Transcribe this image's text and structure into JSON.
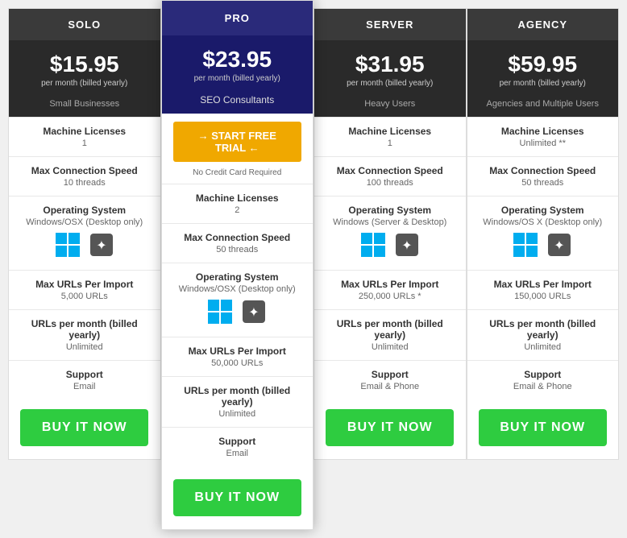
{
  "plans": [
    {
      "id": "solo",
      "name": "SOLO",
      "price": "$15.95",
      "period": "per month (billed yearly)",
      "subtitle": "Small Businesses",
      "featured": false,
      "trial_btn": null,
      "no_credit": null,
      "features": [
        {
          "label": "Machine Licenses",
          "value": "1"
        },
        {
          "label": "Max Connection Speed",
          "value": "10 threads"
        },
        {
          "label": "Operating System",
          "value": "Windows/OSX (Desktop only)"
        },
        {
          "label": "Max URLs Per Import",
          "value": "5,000 URLs"
        },
        {
          "label": "URLs per month (billed yearly)",
          "value": "Unlimited"
        },
        {
          "label": "Support",
          "value": "Email"
        }
      ],
      "buy_label": "BUY IT NOW"
    },
    {
      "id": "pro",
      "name": "PRO",
      "price": "$23.95",
      "period": "per month (billed yearly)",
      "subtitle": "SEO Consultants",
      "featured": true,
      "trial_btn": "→ START FREE TRIAL ←",
      "no_credit": "No Credit Card Required",
      "features": [
        {
          "label": "Machine Licenses",
          "value": "2"
        },
        {
          "label": "Max Connection Speed",
          "value": "50 threads"
        },
        {
          "label": "Operating System",
          "value": "Windows/OSX (Desktop only)"
        },
        {
          "label": "Max URLs Per Import",
          "value": "50,000 URLs"
        },
        {
          "label": "URLs per month (billed yearly)",
          "value": "Unlimited"
        },
        {
          "label": "Support",
          "value": "Email"
        }
      ],
      "buy_label": "BUY IT NOW"
    },
    {
      "id": "server",
      "name": "SERVER",
      "price": "$31.95",
      "period": "per month (billed yearly)",
      "subtitle": "Heavy Users",
      "featured": false,
      "trial_btn": null,
      "no_credit": null,
      "features": [
        {
          "label": "Machine Licenses",
          "value": "1"
        },
        {
          "label": "Max Connection Speed",
          "value": "100 threads"
        },
        {
          "label": "Operating System",
          "value": "Windows (Server & Desktop)"
        },
        {
          "label": "Max URLs Per Import",
          "value": "250,000 URLs *"
        },
        {
          "label": "URLs per month (billed yearly)",
          "value": "Unlimited"
        },
        {
          "label": "Support",
          "value": "Email & Phone"
        }
      ],
      "buy_label": "BUY IT NOW"
    },
    {
      "id": "agency",
      "name": "AGENCY",
      "price": "$59.95",
      "period": "per month (billed yearly)",
      "subtitle": "Agencies and Multiple Users",
      "featured": false,
      "trial_btn": null,
      "no_credit": null,
      "features": [
        {
          "label": "Machine Licenses",
          "value": "Unlimited **"
        },
        {
          "label": "Max Connection Speed",
          "value": "50 threads"
        },
        {
          "label": "Operating System",
          "value": "Windows/OS X (Desktop only)"
        },
        {
          "label": "Max URLs Per Import",
          "value": "150,000 URLs"
        },
        {
          "label": "URLs per month (billed yearly)",
          "value": "Unlimited"
        },
        {
          "label": "Support",
          "value": "Email & Phone"
        }
      ],
      "buy_label": "BUY IT NOW"
    }
  ]
}
